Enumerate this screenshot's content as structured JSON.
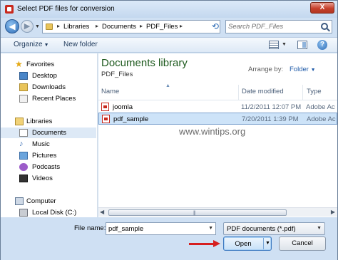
{
  "window": {
    "title": "Select PDF files for conversion",
    "close_label": "X"
  },
  "address": {
    "breadcrumbs": [
      "Libraries",
      "Documents",
      "PDF_Files"
    ],
    "separator": "▸",
    "search_placeholder": "Search PDF_Files"
  },
  "toolbar": {
    "organize_label": "Organize",
    "new_folder_label": "New folder",
    "help_label": "?"
  },
  "nav": {
    "favorites": {
      "label": "Favorites",
      "items": [
        "Desktop",
        "Downloads",
        "Recent Places"
      ]
    },
    "libraries": {
      "label": "Libraries",
      "items": [
        "Documents",
        "Music",
        "Pictures",
        "Podcasts",
        "Videos"
      ],
      "selected": "Documents"
    },
    "computer": {
      "label": "Computer",
      "items": [
        "Local Disk (C:)"
      ]
    }
  },
  "library": {
    "title": "Documents library",
    "subtitle": "PDF_Files",
    "arrange_label": "Arrange by:",
    "arrange_value": "Folder"
  },
  "columns": {
    "name": "Name",
    "date": "Date modified",
    "type": "Type"
  },
  "files": [
    {
      "name": "joomla",
      "date": "11/2/2011 12:07 PM",
      "type": "Adobe Ac"
    },
    {
      "name": "pdf_sample",
      "date": "7/20/2011 1:39 PM",
      "type": "Adobe Ac",
      "selected": true
    }
  ],
  "watermark": "www.wintips.org",
  "footer": {
    "filename_label": "File name:",
    "filename_value": "pdf_sample",
    "filter_value": "PDF documents (*.pdf)",
    "open_label": "Open",
    "cancel_label": "Cancel"
  },
  "colors": {
    "arrow": "#d61f1f",
    "library_title": "#1e5a1e",
    "selection": "#cde3f8"
  }
}
